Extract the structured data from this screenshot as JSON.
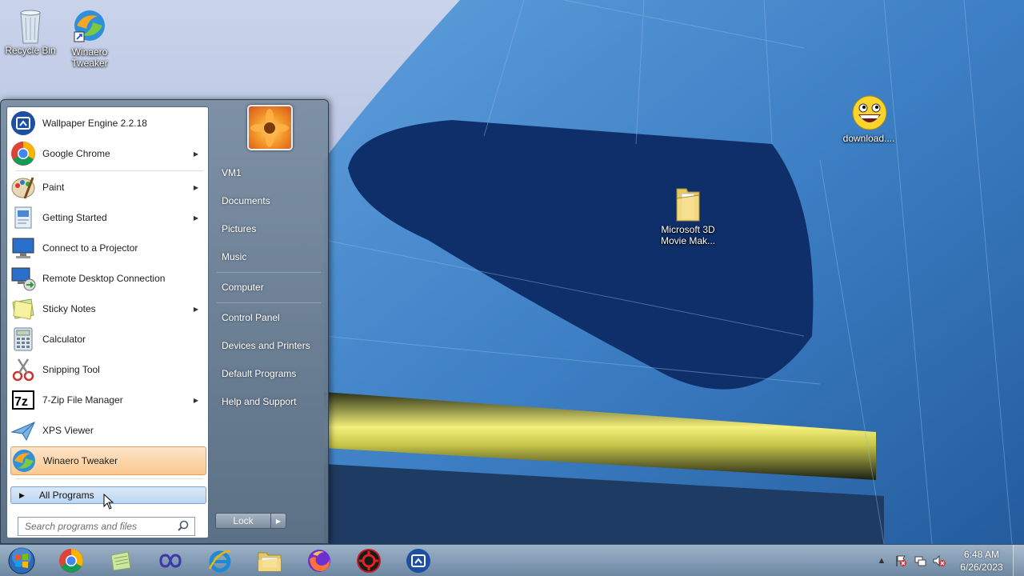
{
  "desktop": {
    "icons": [
      {
        "label": "Recycle Bin",
        "icon": "recycle-bin-icon"
      },
      {
        "label": "Winaero\nTweaker",
        "icon": "winaero-tweaker-icon"
      },
      {
        "label": "download....",
        "icon": "awesome-face-icon"
      },
      {
        "label": "Microsoft 3D\nMovie Mak...",
        "icon": "folder-icon"
      }
    ]
  },
  "start_menu": {
    "programs": [
      {
        "label": "Wallpaper Engine 2.2.18",
        "icon": "wallpaper-engine-icon",
        "has_submenu": false
      },
      {
        "label": "Google Chrome",
        "icon": "chrome-icon",
        "has_submenu": true
      },
      {
        "label": "Paint",
        "icon": "paint-icon",
        "has_submenu": true
      },
      {
        "label": "Getting Started",
        "icon": "getting-started-icon",
        "has_submenu": true
      },
      {
        "label": "Connect to a Projector",
        "icon": "projector-icon",
        "has_submenu": false
      },
      {
        "label": "Remote Desktop Connection",
        "icon": "remote-desktop-icon",
        "has_submenu": false
      },
      {
        "label": "Sticky Notes",
        "icon": "sticky-notes-icon",
        "has_submenu": true
      },
      {
        "label": "Calculator",
        "icon": "calculator-icon",
        "has_submenu": false
      },
      {
        "label": "Snipping Tool",
        "icon": "snipping-tool-icon",
        "has_submenu": false
      },
      {
        "label": "7-Zip File Manager",
        "icon": "7zip-icon",
        "has_submenu": true
      },
      {
        "label": "XPS Viewer",
        "icon": "xps-viewer-icon",
        "has_submenu": false
      },
      {
        "label": "Winaero Tweaker",
        "icon": "winaero-tweaker-icon",
        "has_submenu": false,
        "highlighted": true
      }
    ],
    "all_programs_label": "All Programs",
    "search_placeholder": "Search programs and files",
    "right_links": [
      {
        "label": "VM1"
      },
      {
        "label": "Documents"
      },
      {
        "label": "Pictures"
      },
      {
        "label": "Music"
      },
      {
        "label": "Computer"
      },
      {
        "label": "Control Panel"
      },
      {
        "label": "Devices and Printers"
      },
      {
        "label": "Default Programs"
      },
      {
        "label": "Help and Support"
      }
    ],
    "lock_label": "Lock"
  },
  "taskbar": {
    "pinned": [
      {
        "icon": "chrome-icon"
      },
      {
        "icon": "notepad-icon"
      },
      {
        "icon": "infinity-app-icon"
      },
      {
        "icon": "internet-explorer-icon"
      },
      {
        "icon": "file-explorer-icon"
      },
      {
        "icon": "firefox-icon"
      },
      {
        "icon": "red-gear-app-icon"
      },
      {
        "icon": "wallpaper-engine-icon"
      }
    ],
    "clock_time": "6:48 AM",
    "clock_date": "6/26/2023"
  },
  "colors": {
    "highlight": "#fbc98f",
    "all_programs_bg": "#bcd6f2",
    "sky": "#b8c4e2",
    "building": "#2f6fb8"
  }
}
